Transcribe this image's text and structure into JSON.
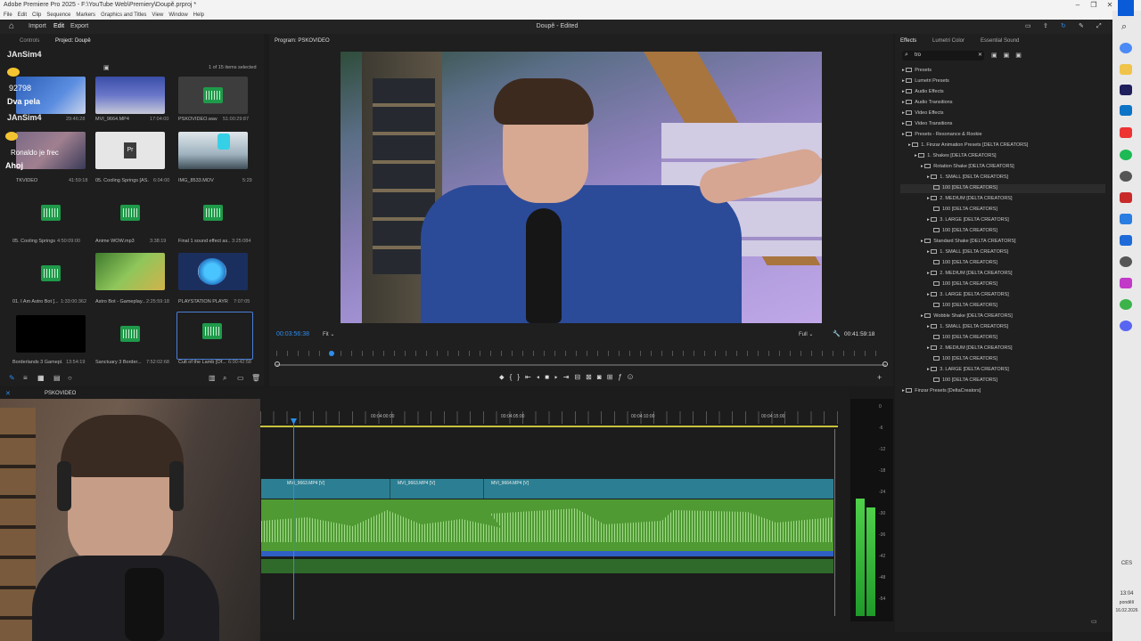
{
  "window": {
    "title": "Adobe Premiere Pro 2025 - F:\\YouTube Web\\Premiery\\Doupě.prproj *",
    "menus": [
      "File",
      "Edit",
      "Clip",
      "Sequence",
      "Markers",
      "Graphics and Titles",
      "View",
      "Window",
      "Help"
    ],
    "doc_title": "Doupě - Edited"
  },
  "header": {
    "tabs": [
      "Import",
      "Edit",
      "Export"
    ]
  },
  "project": {
    "tabs": [
      "Controls",
      "Project: Doupě"
    ],
    "count": "1 of 15 items selected",
    "items": [
      {
        "name": "",
        "dur": "29:46:28"
      },
      {
        "name": "MVI_9664.MP4",
        "dur": "17:04:00"
      },
      {
        "name": "PSKOVIDEO.wav",
        "dur": "51:00:29:87"
      },
      {
        "name": "TKVIDEO",
        "dur": "41:59:18"
      },
      {
        "name": "05. Cooling Springs [AS...",
        "dur": "6:04:00"
      },
      {
        "name": "IMG_8533.MOV",
        "dur": "5:29"
      },
      {
        "name": "05. Cooling Springs ...",
        "dur": "4:50:09:00"
      },
      {
        "name": "Anime WOW.mp3",
        "dur": "3:38:19"
      },
      {
        "name": "Final 1 sound effect as...",
        "dur": "3:25:084"
      },
      {
        "name": "01. I Am Astro Bot [...",
        "dur": "1:33:00:362"
      },
      {
        "name": "Astro Bot - Gameplay...",
        "dur": "2:25:59:18"
      },
      {
        "name": "PLAYSTATION PLAYR...",
        "dur": "7:07:05"
      },
      {
        "name": "Borderlands 3 Gamepl...",
        "dur": "13:54:19"
      },
      {
        "name": "Sanctuary 3 Border...",
        "dur": "7:52:02:68"
      },
      {
        "name": "Cult of the Lamb [Of...",
        "dur": "6:00:42:58"
      }
    ]
  },
  "overlay": {
    "name1": "JAnSim4",
    "num": "92798",
    "dva": "Dva pela",
    "name2": "JAnSim4",
    "ahoj": "Ahoj",
    "chat2": "Ronaldo je frec"
  },
  "monitor": {
    "label": "Program: PSKOVIDEO",
    "timecode": "00:03:56:38",
    "fit": "Fit",
    "full": "Full",
    "duration": "00:41:59:18"
  },
  "timeline": {
    "seq": "PSKOVIDEO",
    "ticks": [
      "00:04:00:00",
      "00:04:05:00",
      "00:04:10:00",
      "00:04:15:00"
    ],
    "clips": [
      "MVI_9663.MP4 [V]",
      "MVI_9663.MP4 [V]",
      "MVI_9664.MP4 [V]"
    ]
  },
  "effects": {
    "tabs": [
      "Effects",
      "Lumetri Color",
      "Essential Sound"
    ],
    "search": "tro",
    "tree": [
      "Presets",
      "Lumetri Presets",
      "Audio Effects",
      "Audio Transitions",
      "Video Effects",
      "Video Transitions",
      "Presets - Resonance & Rookie",
      "1. Finzar Animation Presets [DELTA CREATORS]",
      "1. Shakes [DELTA CREATORS]",
      "Rotation Shake [DELTA CREATORS]",
      "1. SMALL [DELTA CREATORS]",
      "100 [DELTA CREATORS]",
      "2. MEDIUM [DELTA CREATORS]",
      "100 [DELTA CREATORS]",
      "3. LARGE [DELTA CREATORS]",
      "100 [DELTA CREATORS]",
      "Standard Shake [DELTA CREATORS]",
      "1. SMALL [DELTA CREATORS]",
      "100 [DELTA CREATORS]",
      "2. MEDIUM [DELTA CREATORS]",
      "100 [DELTA CREATORS]",
      "3. LARGE [DELTA CREATORS]",
      "100 [DELTA CREATORS]",
      "Wobble Shake [DELTA CREATORS]",
      "1. SMALL [DELTA CREATORS]",
      "100 [DELTA CREATORS]",
      "2. MEDIUM [DELTA CREATORS]",
      "100 [DELTA CREATORS]",
      "3. LARGE [DELTA CREATORS]",
      "100 [DELTA CREATORS]",
      "Finzar Presets [DeltaCreators]"
    ]
  },
  "meter": {
    "ticks": [
      "0",
      "-6",
      "-12",
      "-18",
      "-24",
      "-30",
      "-36",
      "-42",
      "-48",
      "-54"
    ]
  },
  "clock": {
    "lang": "CES",
    "time": "13:04",
    "day": "pondělí",
    "date": "16.02.2026"
  },
  "colors": {
    "accent": "#2d8ceb",
    "video_clip": "#2c7f93",
    "audio_clip": "#56a838"
  }
}
